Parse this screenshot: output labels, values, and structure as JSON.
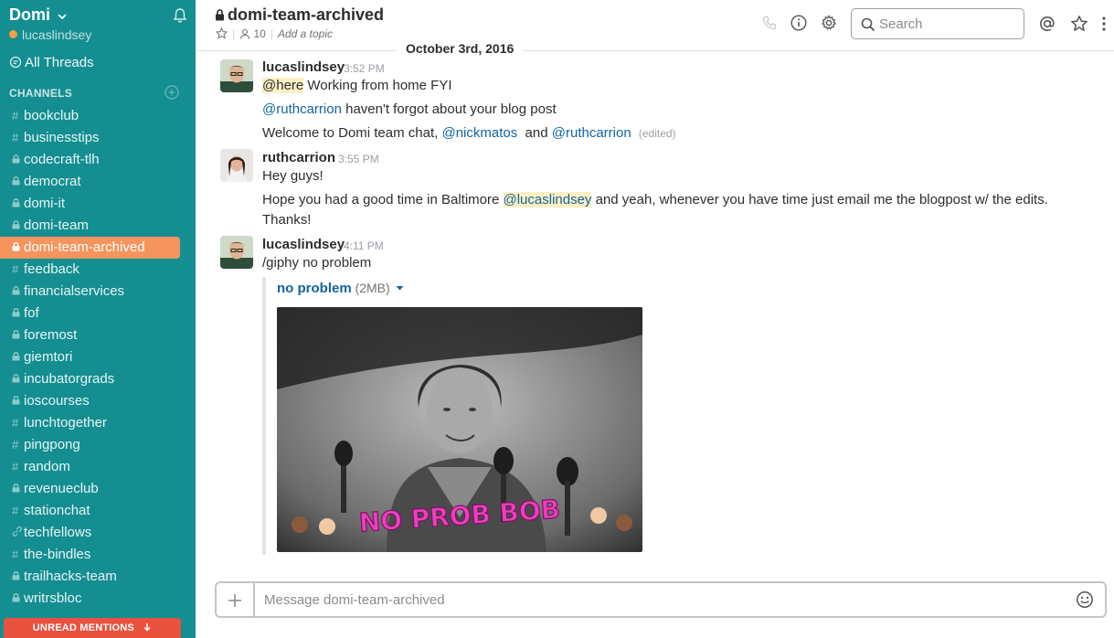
{
  "sidebar": {
    "team_name": "Domi",
    "user_name": "lucaslindsey",
    "all_threads": "All Threads",
    "channels_header": "CHANNELS",
    "channels": [
      {
        "prefix": "#",
        "name": "bookclub"
      },
      {
        "prefix": "#",
        "name": "businesstips"
      },
      {
        "prefix": "lock",
        "name": "codecraft-tlh"
      },
      {
        "prefix": "lock",
        "name": "democrat"
      },
      {
        "prefix": "lock",
        "name": "domi-it"
      },
      {
        "prefix": "lock",
        "name": "domi-team"
      },
      {
        "prefix": "lock",
        "name": "domi-team-archived",
        "active": true
      },
      {
        "prefix": "#",
        "name": "feedback"
      },
      {
        "prefix": "lock",
        "name": "financialservices"
      },
      {
        "prefix": "lock",
        "name": "fof"
      },
      {
        "prefix": "lock",
        "name": "foremost"
      },
      {
        "prefix": "lock",
        "name": "giemtori"
      },
      {
        "prefix": "lock",
        "name": "incubatorgrads"
      },
      {
        "prefix": "lock",
        "name": "ioscourses"
      },
      {
        "prefix": "#",
        "name": "lunchtogether"
      },
      {
        "prefix": "#",
        "name": "pingpong"
      },
      {
        "prefix": "#",
        "name": "random"
      },
      {
        "prefix": "lock",
        "name": "revenueclub"
      },
      {
        "prefix": "#",
        "name": "stationchat"
      },
      {
        "prefix": "link",
        "name": "techfellows"
      },
      {
        "prefix": "#",
        "name": "the-bindles"
      },
      {
        "prefix": "lock",
        "name": "trailhacks-team"
      },
      {
        "prefix": "lock",
        "name": "writrsbloc"
      }
    ],
    "unread_mentions": "UNREAD MENTIONS"
  },
  "header": {
    "channel_name": "domi-team-archived",
    "member_count": "10",
    "topic_placeholder": "Add a topic",
    "search_placeholder": "Search"
  },
  "date_divider": "October 3rd, 2016",
  "messages": [
    {
      "user": "lucaslindsey",
      "time": "3:52 PM",
      "l1_here": "@here",
      "l1_text": " Working from home FYI",
      "l2_mention": "@ruthcarrion",
      "l2_text": " haven't forgot about your blog post",
      "l3_text": "Welcome to Domi team chat, ",
      "l3_mention1": "@nickmatos",
      "l3_and": "  and ",
      "l3_mention2": "@ruthcarrion",
      "l3_edited": "(edited)"
    },
    {
      "user": "ruthcarrion",
      "time": "3:55 PM",
      "l1_text": "Hey guys!",
      "l2_text": "Hope you had a good time in Baltimore ",
      "l2_mention": "@lucaslindsey",
      "l2_rest": " and yeah, whenever you have time just email me the blogpost w/ the edits.",
      "l3_text": "Thanks!"
    },
    {
      "user": "lucaslindsey",
      "time": "4:11 PM",
      "l1_text": "/giphy no problem",
      "attachment_title": "no problem",
      "attachment_size": " (2MB)",
      "gif_caption": "NO PROB BOB"
    }
  ],
  "composer": {
    "placeholder": "Message domi-team-archived"
  },
  "colors": {
    "sidebar": "#148e91",
    "active_channel": "#f5955d",
    "unread_mentions": "#e8523f",
    "link": "#1264a3",
    "highlight": "#fcf0c3"
  }
}
